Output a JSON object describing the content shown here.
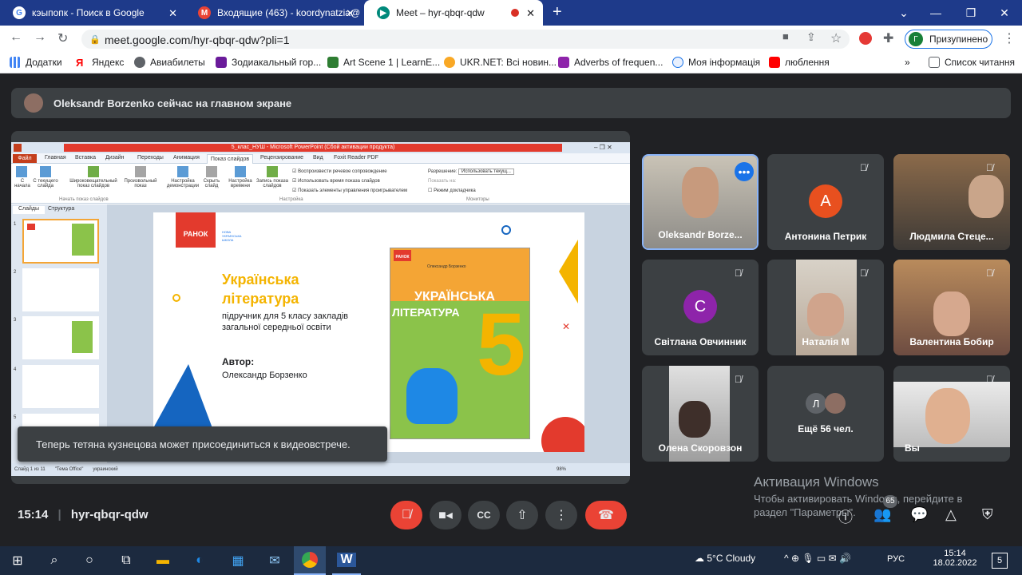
{
  "browser": {
    "tabs": [
      {
        "label": "кэыпопк - Поиск в Google",
        "icon": "google-g-icon",
        "color": "#ffffff"
      },
      {
        "label": "Входящие (463) - koordynatzia@",
        "icon": "gmail-icon",
        "color": "#ea4335"
      },
      {
        "label": "Meet – hyr-qbqr-qdw",
        "icon": "meet-icon",
        "color": "#00897b"
      }
    ],
    "url": "meet.google.com/hyr-qbqr-qdw?pli=1",
    "profile_label": "Призупинено",
    "profile_initial": "Г",
    "bookmarks": [
      {
        "label": "Додатки",
        "color": "#5f6368"
      },
      {
        "label": "Яндекс",
        "color": "#ff0000"
      },
      {
        "label": "Авиабилеты",
        "color": "#5f6368"
      },
      {
        "label": "Зодиакальный гор...",
        "color": "#6a1b9a"
      },
      {
        "label": "Art Scene 1 | LearnE...",
        "color": "#2e7d32"
      },
      {
        "label": "UKR.NET: Всі новин...",
        "color": "#f9a825"
      },
      {
        "label": "Adverbs of frequen...",
        "color": "#8e24aa"
      },
      {
        "label": "Моя інформація",
        "color": "#1a73e8"
      },
      {
        "label": "люблення",
        "color": "#ff0000"
      }
    ],
    "reading_list": "Список читання"
  },
  "meet": {
    "banner": "Oleksandr Borzenko сейчас на главном экране",
    "meeting_time": "15:14",
    "meeting_code": "hyr-qbqr-qdw",
    "toast": "Теперь тетяна кузнецова может присоединиться к видеовстрече.",
    "participants": [
      {
        "name": "Oleksandr Borze...",
        "type": "video",
        "active": true
      },
      {
        "name": "Антонина Петрик",
        "type": "avatar",
        "initial": "А",
        "color": "#e8501f"
      },
      {
        "name": "Людмила Стеце...",
        "type": "video"
      },
      {
        "name": "Світлана Овчинник",
        "type": "avatar",
        "initial": "С",
        "color": "#8e24aa"
      },
      {
        "name": "Наталія М",
        "type": "video"
      },
      {
        "name": "Валентина Бобир",
        "type": "video"
      },
      {
        "name": "Олена Скоровзон",
        "type": "video"
      },
      {
        "name": "Ещё 56 чел.",
        "type": "more",
        "initial": "Л"
      },
      {
        "name": "Вы",
        "type": "video"
      }
    ],
    "people_count": "65",
    "activation_title": "Активация Windows",
    "activation_text_1": "Чтобы активировать Windows, перейдите в",
    "activation_text_2": "раздел \"Параметры\"."
  },
  "ppt": {
    "title": "5_клас_НУШ - Microsoft PowerPoint (Сбой активации продукта)",
    "tabs": [
      "Файл",
      "Главная",
      "Вставка",
      "Дизайн",
      "Переходы",
      "Анимация",
      "Показ слайдов",
      "Рецензирование",
      "Вид",
      "Foxit Reader PDF"
    ],
    "ribbon_buttons": [
      "С начала",
      "С текущего слайда",
      "Широковещательный показ слайдов",
      "Произвольный показ",
      "Настройка демонстрации",
      "Скрыть слайд",
      "Настройка времени",
      "Запись показа слайдов"
    ],
    "checkboxes": [
      "Воспроизвести речевое сопровождение",
      "Использовать время показа слайдов",
      "Показать элементы управления проигрывателем"
    ],
    "resolution_label": "Разрешение:",
    "resolution_value": "Использовать текущ...",
    "show_on_label": "Показать на:",
    "presenter_view": "Режим докладчика",
    "group_labels": [
      "Начать показ слайдов",
      "Настройка",
      "Мониторы"
    ],
    "panel_tabs": [
      "Слайды",
      "Структура"
    ],
    "slide": {
      "publisher": "РАНОК",
      "nush": "НОВА УКРАЇНСЬКА ШКОЛА",
      "title_1": "Українська",
      "title_2": "література",
      "subtitle_1": "підручник для 5 класу закладів",
      "subtitle_2": "загальної середньої освіти",
      "author_label": "Автор:",
      "author_name": "Олександр Борзенко",
      "book_author": "Олександр Борзенко",
      "book_title_1": "УКРАЇНСЬКА",
      "book_title_2": "ЛІТЕРАТУРА",
      "book_number": "5"
    },
    "status_slide": "Слайд 1 из 11",
    "status_theme": "\"Тема Office\"",
    "status_lang": "украинский",
    "status_zoom": "98%"
  },
  "taskbar": {
    "weather": "5°C  Cloudy",
    "lang": "РУС",
    "time": "15:14",
    "date": "18.02.2022",
    "notifications": "5"
  }
}
